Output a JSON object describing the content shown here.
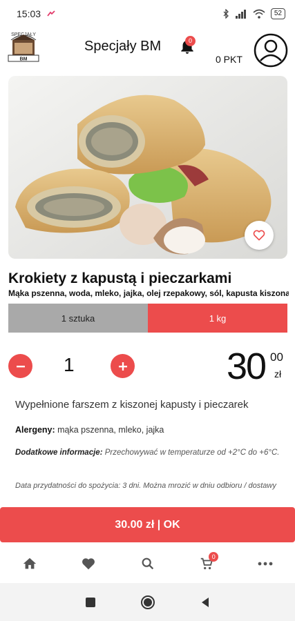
{
  "status_bar": {
    "time": "15:03",
    "battery": "52"
  },
  "header": {
    "logo_text_top": "SPECJAŁY",
    "logo_text_bottom": "BM",
    "title": "Specjały BM",
    "notification_count": "0",
    "points": "0 PKT"
  },
  "product": {
    "name": "Krokiety z kapustą i pieczarkami",
    "ingredients": "Mąka pszenna, woda, mleko, jajka, olej rzepakowy, sól, kapusta kiszona, pieczarki",
    "variants": [
      {
        "label": "1 sztuka",
        "selected": false
      },
      {
        "label": "1 kg",
        "selected": true
      }
    ],
    "quantity": "1",
    "price_main": "30",
    "price_cents": "00",
    "price_currency": "zł",
    "description": "Wypełnione farszem z kiszonej kapusty i pieczarek",
    "allergens_label": "Alergeny:",
    "allergens_value": " mąka pszenna, mleko, jajka",
    "extra_label": "Dodatkowe informacje:",
    "extra_value": " Przechowywać w temperaturze od +2°C do +6°C.",
    "shelf_life": "Data przydatności do spożycia: 3 dni. Można mrozić w dniu odbioru / dostawy"
  },
  "order_button": "30.00 zł | OK",
  "bottom_nav": {
    "cart_count": "0"
  },
  "colors": {
    "accent": "#ec4c4c",
    "variant_inactive": "#a9a9a9"
  },
  "icons": [
    "bell-icon",
    "account-icon",
    "heart-icon",
    "minus-icon",
    "plus-icon",
    "home-icon",
    "favorites-icon",
    "search-icon",
    "cart-icon",
    "more-icon"
  ]
}
